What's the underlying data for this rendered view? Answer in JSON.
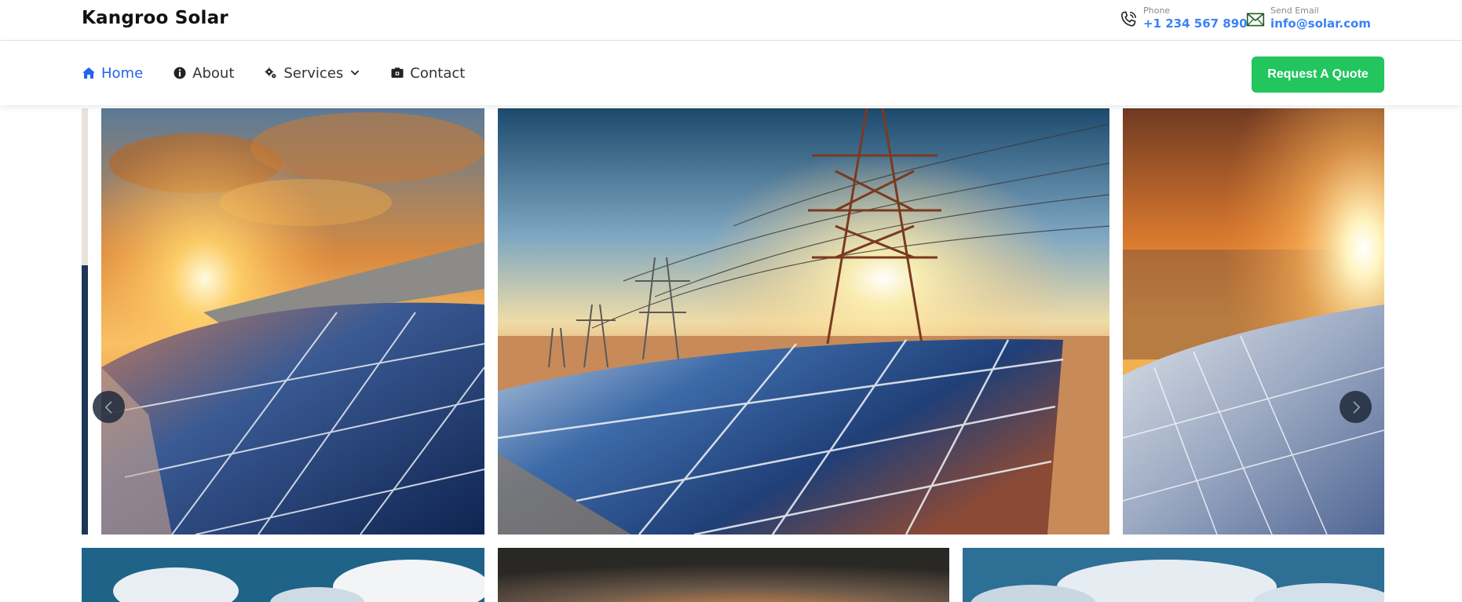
{
  "brand": {
    "name": "Kangroo Solar"
  },
  "contact": {
    "phone": {
      "label": "Phone",
      "value": "+1 234 567 890",
      "icon": "phone-icon"
    },
    "email": {
      "label": "Send Email",
      "value": "info@solar.com",
      "icon": "envelope-icon"
    }
  },
  "nav": {
    "items": [
      {
        "label": "Home",
        "icon": "home-icon",
        "active": true
      },
      {
        "label": "About",
        "icon": "info-icon",
        "active": false
      },
      {
        "label": "Services",
        "icon": "gears-icon",
        "active": false,
        "dropdown": true
      },
      {
        "label": "Contact",
        "icon": "contact-card-icon",
        "active": false
      }
    ],
    "cta_label": "Request A Quote"
  },
  "carousel": {
    "prev_icon": "chevron-left-icon",
    "next_icon": "chevron-right-icon",
    "images": [
      "solar-panels-sunset-image",
      "power-tower-solar-image",
      "solar-panels-sunburst-image",
      "solar-panels-sky-image",
      "solar-dusk-image",
      "solar-clouds-image"
    ]
  },
  "colors": {
    "accent": "#2563eb",
    "link": "#3b82f6",
    "cta": "#22c55e",
    "arrow_bg": "#1e293b"
  }
}
